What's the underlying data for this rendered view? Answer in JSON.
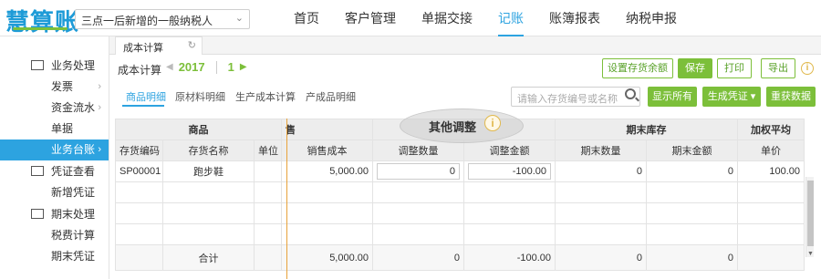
{
  "brand": {
    "logo_text": "慧算账"
  },
  "company": {
    "selected": "三点一后新增的一般纳税人"
  },
  "nav": {
    "items": [
      "首页",
      "客户管理",
      "单据交接",
      "记账",
      "账簿报表",
      "纳税申报"
    ],
    "active_index": 3
  },
  "sidebar": {
    "groups": [
      {
        "label": "业务处理",
        "icon": "folder-icon",
        "items": [
          {
            "label": "发票",
            "has_arrow": true
          },
          {
            "label": "资金流水",
            "has_arrow": true
          },
          {
            "label": "单据",
            "has_arrow": false
          },
          {
            "label": "业务台账",
            "has_arrow": true,
            "active": true
          }
        ]
      },
      {
        "label": "凭证查看",
        "icon": "voucher-icon",
        "items": [
          {
            "label": "新增凭证",
            "has_arrow": false
          }
        ]
      },
      {
        "label": "期末处理",
        "icon": "period-end-icon",
        "items": [
          {
            "label": "税费计算",
            "has_arrow": false
          },
          {
            "label": "期末凭证",
            "has_arrow": false
          }
        ]
      }
    ]
  },
  "tab": {
    "label": "成本计算"
  },
  "toolbar": {
    "title": "成本计算",
    "year": "2017",
    "month": "1",
    "buttons": {
      "set_inventory": "设置存货余额",
      "save": "保存",
      "print": "打印",
      "export": "导出"
    }
  },
  "subtabs": {
    "items": [
      "商品明细",
      "原材料明细",
      "生产成本计算",
      "产成品明细"
    ],
    "active_index": 0
  },
  "search": {
    "placeholder": "请输入存货编号或名称"
  },
  "actions": {
    "show_all": "显示所有",
    "gen_voucher": "生成凭证",
    "refetch": "重获数据"
  },
  "highlight": {
    "label": "其他调整"
  },
  "table": {
    "group_headers": {
      "goods": "商品",
      "sales": "售",
      "adjust": "",
      "period_end": "期末库存",
      "weighted": "加权平均"
    },
    "columns": [
      "存货编码",
      "存货名称",
      "单位",
      "销售成本",
      "调整数量",
      "调整金额",
      "期末数量",
      "期末金额",
      "单价"
    ],
    "rows": [
      {
        "code": "SP00001",
        "name": "跑步鞋",
        "unit": "",
        "sales_cost": "5,000.00",
        "adj_qty": "0",
        "adj_amount": "-100.00",
        "end_qty": "0",
        "end_amount": "0",
        "unit_price": "100.00"
      }
    ],
    "total": {
      "label": "合计",
      "sales_cost": "5,000.00",
      "adj_qty": "0",
      "adj_amount": "-100.00",
      "end_qty": "0",
      "end_amount": "0"
    }
  },
  "colors": {
    "accent_blue": "#2da3e0",
    "accent_green": "#7cbf3a",
    "highlight_gray": "#cdcdcd"
  }
}
